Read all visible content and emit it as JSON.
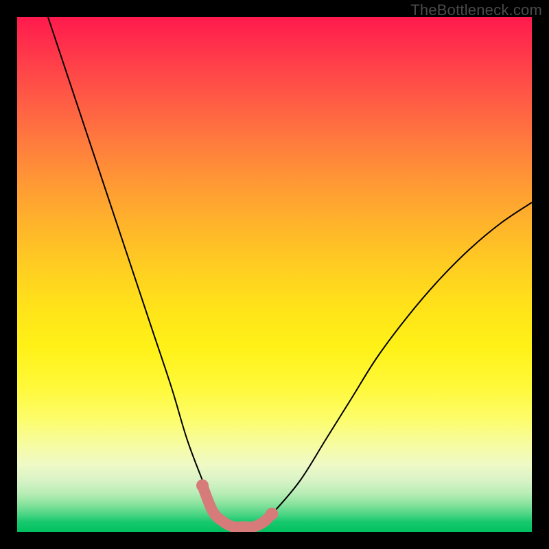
{
  "watermark": "TheBottleneck.com",
  "chart_data": {
    "type": "line",
    "title": "",
    "xlabel": "",
    "ylabel": "",
    "xlim": [
      0,
      100
    ],
    "ylim": [
      0,
      100
    ],
    "grid": false,
    "legend": false,
    "background_gradient": {
      "top": "#ff1a4d",
      "mid": "#ffe21a",
      "bottom": "#00c060"
    },
    "series": [
      {
        "name": "bottleneck-curve",
        "color": "#000000",
        "width": 2,
        "x": [
          6,
          10,
          14,
          18,
          22,
          26,
          30,
          33,
          36,
          38,
          40,
          42,
          44,
          46,
          48,
          50,
          55,
          60,
          65,
          70,
          76,
          82,
          88,
          94,
          100
        ],
        "y": [
          100,
          88,
          76,
          64,
          52,
          40,
          28,
          18,
          10,
          5,
          2,
          1,
          1,
          1,
          2,
          4,
          10,
          18,
          26,
          34,
          42,
          49,
          55,
          60,
          64
        ]
      },
      {
        "name": "highlight-pink",
        "color": "#d77a7a",
        "width": 10,
        "linecap": "round",
        "x": [
          36,
          38,
          40,
          42,
          44,
          46,
          48,
          49.5
        ],
        "y": [
          9,
          4,
          2,
          1,
          1,
          1,
          2,
          3.5
        ]
      }
    ]
  }
}
